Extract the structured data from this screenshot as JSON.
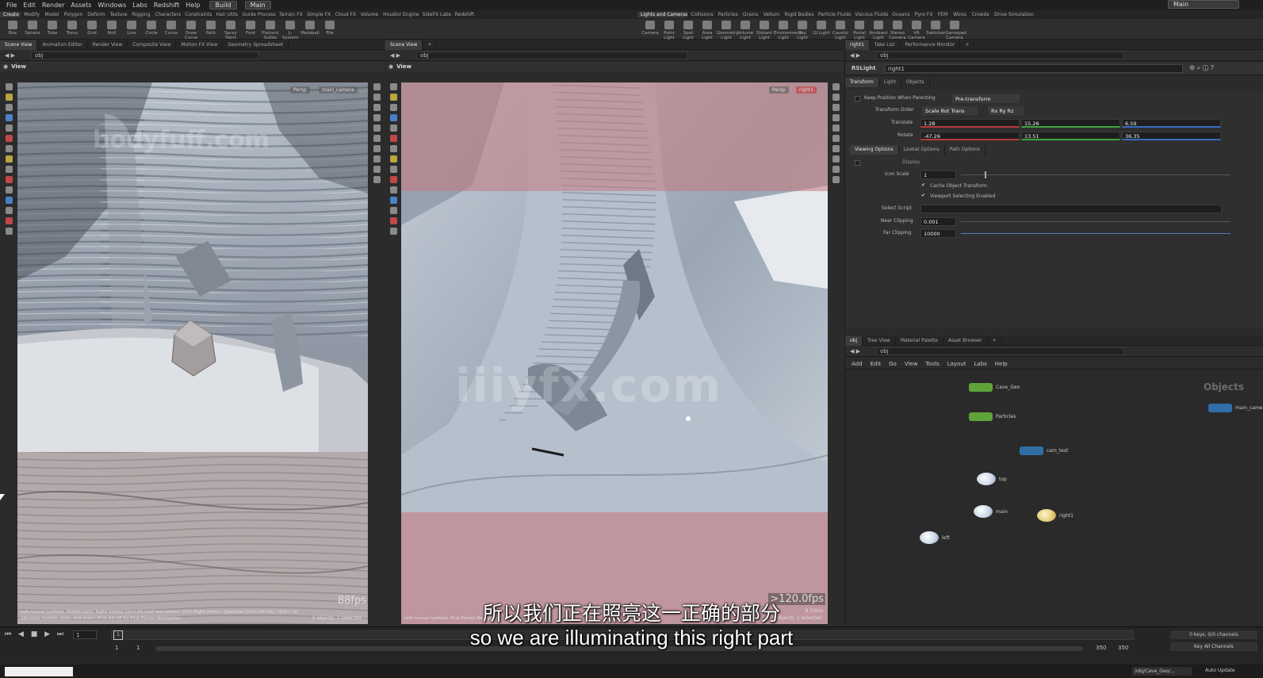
{
  "app": {
    "menu": [
      "File",
      "Edit",
      "Render",
      "Assets",
      "Windows",
      "Labs",
      "Redshift",
      "Help"
    ],
    "desktop_label": "Build",
    "workspace_label": "Main"
  },
  "shelf": {
    "tabs_left": [
      "Create",
      "Modify",
      "Model",
      "Polygon",
      "Deform",
      "Texture",
      "Rigging",
      "Characters",
      "Constraints",
      "Hair Utils",
      "Guide Process",
      "Terrain FX",
      "Simple FX",
      "Cloud FX",
      "Volume",
      "Houdini Engine",
      "SideFX Labs",
      "Redshift"
    ],
    "tabs_right": [
      "Lights and Cameras",
      "Collisions",
      "Particles",
      "Grains",
      "Vellum",
      "Rigid Bodies",
      "Particle Fluids",
      "Viscous Fluids",
      "Oceans",
      "Pyro FX",
      "FEM",
      "Wires",
      "Crowds",
      "Drive Simulation"
    ],
    "tools_left": [
      "Box",
      "Sphere",
      "Tube",
      "Torus",
      "Grid",
      "Null",
      "Line",
      "Circle",
      "Curve",
      "Draw Curve",
      "Path",
      "Spray Paint",
      "Font",
      "Platonic Solids",
      "L-System",
      "Metaball",
      "File"
    ],
    "tools_right": [
      "Camera",
      "Point Light",
      "Spot Light",
      "Area Light",
      "Geometry Light",
      "Volume Light",
      "Distant Light",
      "Environment Light",
      "Sky Light",
      "GI Light",
      "Caustic Light",
      "Portal Light",
      "Ambient Light",
      "Stereo Camera",
      "VR Camera",
      "Switcher",
      "Gamepad Camera"
    ]
  },
  "left_pane": {
    "tabs": [
      "Scene View",
      "Animation Editor",
      "Render View",
      "Composite View",
      "Motion FX View",
      "Geometry Spreadsheet"
    ],
    "path": "obj",
    "viewport_label": "View",
    "cam_chips": [
      "Persp",
      "main_camera"
    ],
    "fps": "88fps",
    "status": "Left mouse tumbles. Middle pans. Right dollies. Ctrl+Alt+Left box-zooms. Ctrl+Right zooms. Spacebar Ctrl+Left tilts. Hold L for alternate tumble, dolly, and zoom.   M or Alt+M for First Person Navigation.",
    "selected": "0 objects, 1 selected",
    "watermark": "bodyfuff.com"
  },
  "mid_pane": {
    "tabs": [
      "Scene View"
    ],
    "path": "obj",
    "viewport_label": "View",
    "cam_chips": [
      "Persp",
      "right1"
    ],
    "fps": ">120.0fps",
    "ms": "8.33ms",
    "status": "Left mouse tumbles.                       First Person Navigation.",
    "selected": "0 objects, 1 selected",
    "watermark": "iiiyfx.com"
  },
  "params": {
    "tabs": [
      "right1",
      "Take List",
      "Performance Monitor"
    ],
    "path": "obj",
    "node_type": "RSLight",
    "node_name": "right1",
    "subtabs": [
      "Transform",
      "Light",
      "Objects"
    ],
    "keep_position": "Keep Position When Parenting",
    "pre_transform": "Pre-transform",
    "transform_order_label": "Transform Order",
    "transform_order": "Scale Rot Trans",
    "rot_order": "Rx Ry Rz",
    "translate_label": "Translate",
    "translate": [
      "1.28",
      "15.26",
      "6.59"
    ],
    "rotate_label": "Rotate",
    "rotate": [
      "-47.26",
      "13.51",
      "36.35"
    ],
    "option_tabs": [
      "Viewing Options",
      "Lookat Options",
      "Path Options"
    ],
    "display_label": "Display",
    "icon_scale_label": "Icon Scale",
    "icon_scale": "1",
    "cache_transform": "Cache Object Transform",
    "viewport_selecting": "Viewport Selecting Enabled",
    "select_script_label": "Select Script",
    "near_clipping_label": "Near Clipping",
    "near_clipping": "0.001",
    "far_clipping_label": "Far Clipping",
    "far_clipping": "10000"
  },
  "network": {
    "tabs": [
      "obj",
      "Tree View",
      "Material Palette",
      "Asset Browser"
    ],
    "path": "obj",
    "menu": [
      "Add",
      "Edit",
      "Go",
      "View",
      "Tools",
      "Layout",
      "Labs",
      "Help"
    ],
    "context_watermark": "Objects",
    "nodes": [
      {
        "name": "Cave_Geo",
        "kind": "geo"
      },
      {
        "name": "Particles",
        "kind": "geo"
      },
      {
        "name": "cam_test",
        "kind": "cam"
      },
      {
        "name": "top",
        "kind": "light"
      },
      {
        "name": "main",
        "kind": "light"
      },
      {
        "name": "right1",
        "kind": "light_sel"
      },
      {
        "name": "left",
        "kind": "light"
      },
      {
        "name": "main_camera",
        "kind": "cam"
      }
    ]
  },
  "timeline": {
    "current_frame": "1",
    "start": "1",
    "start2": "1",
    "end": "350",
    "end2": "350",
    "keys_label": "0 keys, 0/0 channels",
    "key_all": "Key All Channels",
    "auto_update": "Auto Update",
    "path_field": "/obj/Cave_Geo/..."
  },
  "subtitles": {
    "zh": "所以我们正在照亮这一正确的部分",
    "en": "so we are illuminating this right part"
  }
}
